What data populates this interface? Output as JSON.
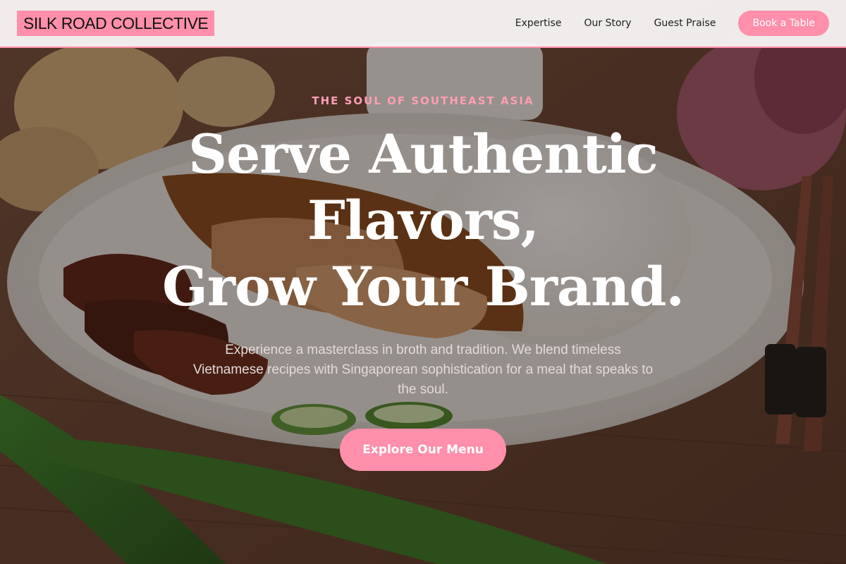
{
  "header": {
    "brand": "SILK ROAD COLLECTIVE",
    "nav": [
      {
        "label": "Expertise"
      },
      {
        "label": "Our Story"
      },
      {
        "label": "Guest Praise"
      }
    ],
    "cta_label": "Book a Table"
  },
  "hero": {
    "eyebrow": "THE SOUL OF SOUTHEAST ASIA",
    "headline_lines": [
      "Serve Authentic",
      "Flavors,",
      "Grow Your Brand."
    ],
    "subcopy": "Experience a masterclass in broth and tradition. We blend timeless Vietnamese recipes with Singaporean sophistication for a meal that speaks to the soul.",
    "cta_label": "Explore Our Menu"
  },
  "colors": {
    "accent": "#ff8fab",
    "eyebrow": "#ff9eb5",
    "header_bg": "#f6f4f4",
    "headline": "#ffffff"
  }
}
